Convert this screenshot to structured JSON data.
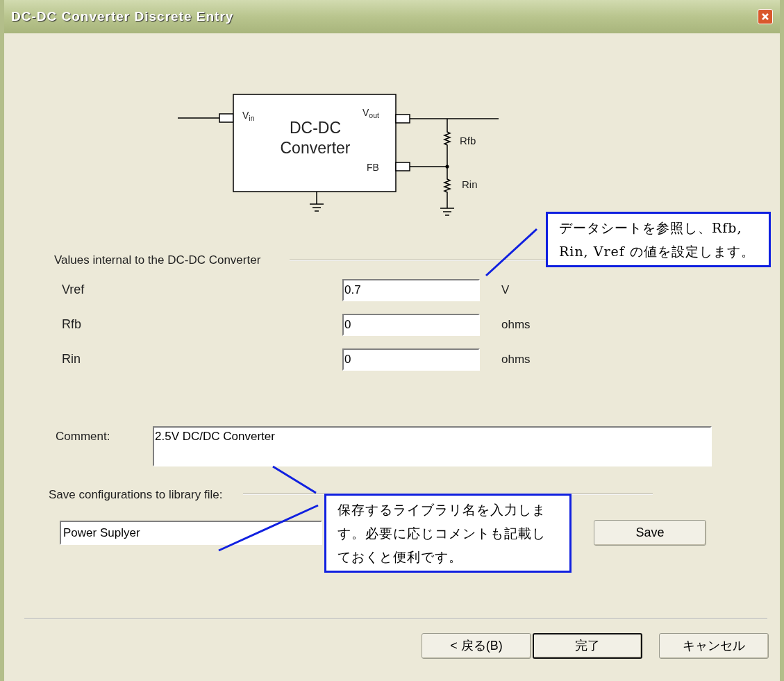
{
  "window": {
    "title": "DC-DC Converter Discrete Entry"
  },
  "diagram": {
    "title": "DC-DC Converter",
    "pins": [
      {
        "label": "V$_{in}$"
      },
      {
        "label": "V$_{out}$"
      },
      {
        "label": "FB"
      }
    ],
    "resistors": [
      {
        "label": "Rfb"
      },
      {
        "label": "Rin"
      }
    ]
  },
  "internal_values": {
    "heading": "Values internal to the DC-DC Converter",
    "rows": [
      {
        "label": "Vref",
        "value": "0.7",
        "unit": "V"
      },
      {
        "label": "Rfb",
        "value": "0",
        "unit": "ohms"
      },
      {
        "label": "Rin",
        "value": "0",
        "unit": "ohms"
      }
    ]
  },
  "comment": {
    "label": "Comment:",
    "value": "2.5V DC/DC Converter"
  },
  "library": {
    "heading": "Save configurations to library file:",
    "value": "Power Suplyer",
    "save_button": "Save"
  },
  "callouts": [
    {
      "text": "データシートを参照し、Rfb, Rin, Vref の値を設定します。"
    },
    {
      "text": "保存するライブラリ名を入力します。必要に応じコメントも記載しておくと便利です。"
    }
  ],
  "buttons": [
    {
      "label": "< 戻る(B)",
      "default": false
    },
    {
      "label": "完了",
      "default": true
    },
    {
      "label": "キャンセル",
      "default": false
    }
  ]
}
